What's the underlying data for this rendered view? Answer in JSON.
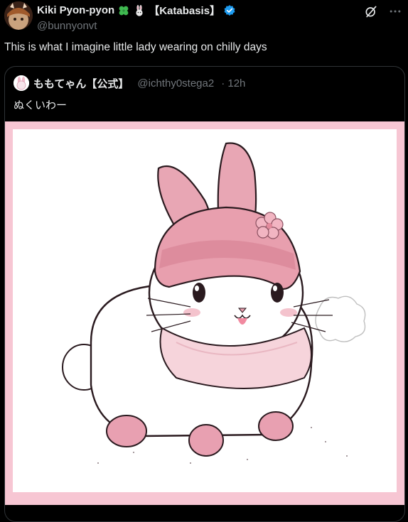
{
  "post": {
    "author": {
      "name": "Kiki Pyon-pyon",
      "name_tag": "【Katabasis】",
      "handle": "@bunnyonvt",
      "emojis": [
        "four-leaf-clover-icon",
        "rabbit-icon"
      ],
      "verified": true
    },
    "text": "This is what I imagine little lady wearing on chilly days"
  },
  "quote": {
    "author": {
      "name": "ももてゃん【公式】",
      "handle": "@ichthy0stega2",
      "time": "· 12h"
    },
    "text": "ぬくいわー",
    "image": {
      "frame_color": "#f7c6d3",
      "subject": "rabbit-illustration"
    }
  },
  "colors": {
    "background": "#000000",
    "text_primary": "#e7e9ea",
    "text_secondary": "#71767b",
    "verified_blue": "#1d9bf0",
    "border": "#2f3336"
  }
}
